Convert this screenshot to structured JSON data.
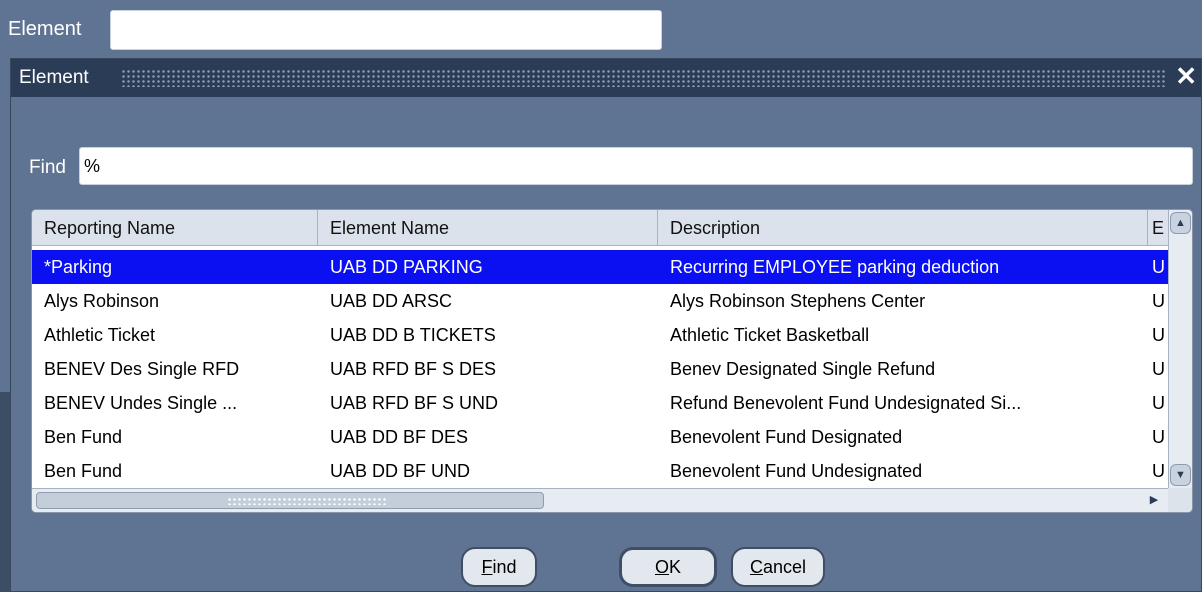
{
  "background": {
    "field_label": "Element",
    "field_value": ""
  },
  "dialog": {
    "title": "Element",
    "close_symbol": "✕",
    "find_label": "Find",
    "find_value": "%",
    "columns": [
      "Reporting Name",
      "Element Name",
      "Description",
      "E"
    ],
    "rows": [
      {
        "reporting_name": "*Parking",
        "element_name": "UAB DD PARKING",
        "description": "Recurring EMPLOYEE parking deduction",
        "e": "U",
        "selected": true
      },
      {
        "reporting_name": "Alys Robinson",
        "element_name": "UAB DD ARSC",
        "description": "Alys Robinson Stephens Center",
        "e": "U",
        "selected": false
      },
      {
        "reporting_name": "Athletic Ticket",
        "element_name": "UAB DD B TICKETS",
        "description": "Athletic Ticket Basketball",
        "e": "U",
        "selected": false
      },
      {
        "reporting_name": "BENEV Des Single RFD",
        "element_name": "UAB RFD BF S DES",
        "description": "Benev Designated Single Refund",
        "e": "U",
        "selected": false
      },
      {
        "reporting_name": "BENEV Undes Single ...",
        "element_name": "UAB RFD BF S UND",
        "description": "Refund Benevolent Fund Undesignated Si...",
        "e": "U",
        "selected": false
      },
      {
        "reporting_name": "Ben Fund",
        "element_name": "UAB DD BF DES",
        "description": "Benevolent Fund Designated",
        "e": "U",
        "selected": false
      },
      {
        "reporting_name": "Ben Fund",
        "element_name": "UAB DD BF UND",
        "description": "Benevolent Fund Undesignated",
        "e": "U",
        "selected": false
      }
    ],
    "buttons": {
      "find": {
        "mnemonic": "F",
        "rest": "ind"
      },
      "ok": {
        "mnemonic": "O",
        "rest": "K"
      },
      "cancel": {
        "mnemonic": "C",
        "rest": "ancel"
      }
    }
  },
  "icons": {
    "scroll_up": "scroll-up-icon",
    "scroll_down": "scroll-down-icon",
    "scroll_left": "scroll-left-icon",
    "scroll_right": "scroll-right-icon"
  },
  "colors": {
    "background": "#5f7492",
    "title_bar": "#2b3c57",
    "selection": "#0a10f2"
  }
}
